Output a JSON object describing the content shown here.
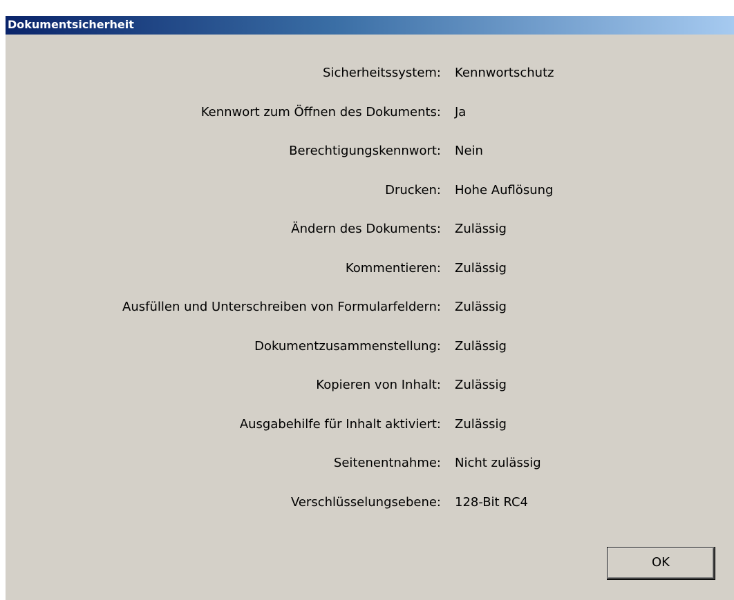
{
  "window": {
    "title": "Dokumentsicherheit",
    "title_gradient": [
      "#0a246a",
      "#3a6ea5",
      "#a6caf0"
    ],
    "background": "#d4d0c8"
  },
  "rows": [
    {
      "label": "Sicherheitssystem:",
      "value": "Kennwortschutz"
    },
    {
      "label": "Kennwort zum Öffnen des Dokuments:",
      "value": "Ja"
    },
    {
      "label": "Berechtigungskennwort:",
      "value": "Nein"
    },
    {
      "label": "Drucken:",
      "value": "Hohe Auflösung"
    },
    {
      "label": "Ändern des Dokuments:",
      "value": "Zulässig"
    },
    {
      "label": "Kommentieren:",
      "value": "Zulässig"
    },
    {
      "label": "Ausfüllen und Unterschreiben von Formularfeldern:",
      "value": "Zulässig"
    },
    {
      "label": "Dokumentzusammenstellung:",
      "value": "Zulässig"
    },
    {
      "label": "Kopieren von Inhalt:",
      "value": "Zulässig"
    },
    {
      "label": "Ausgabehilfe für Inhalt aktiviert:",
      "value": "Zulässig"
    },
    {
      "label": "Seitenentnahme:",
      "value": "Nicht zulässig"
    },
    {
      "label": "Verschlüsselungsebene:",
      "value": "128-Bit RC4"
    }
  ],
  "buttons": {
    "ok_label": "OK"
  }
}
